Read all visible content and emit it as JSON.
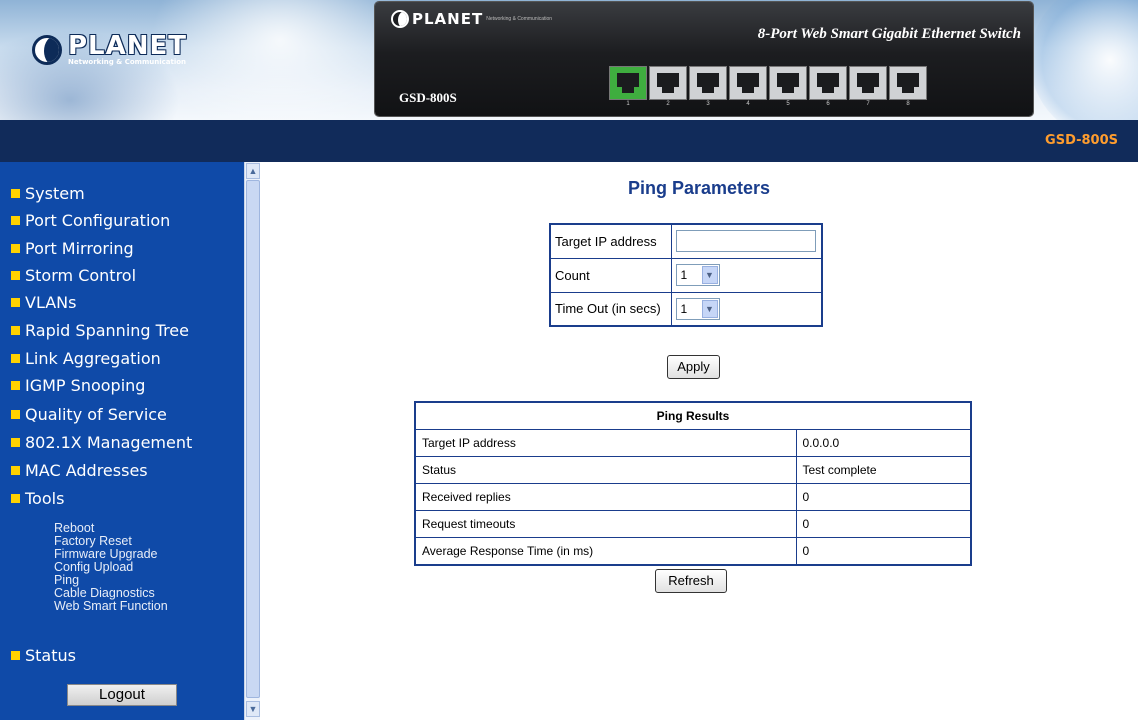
{
  "banner": {
    "brand": "PLANET",
    "brand_tagline": "Networking & Communication",
    "device_title": "8-Port Web Smart Gigabit Ethernet Switch",
    "device_model": "GSD-800S",
    "ports": [
      "1",
      "2",
      "3",
      "4",
      "5",
      "6",
      "7",
      "8"
    ],
    "active_port": "1"
  },
  "topbar": {
    "model": "GSD-800S"
  },
  "sidebar": {
    "items": [
      {
        "label": "System"
      },
      {
        "label": "Port Configuration"
      },
      {
        "label": "Port Mirroring"
      },
      {
        "label": "Storm Control"
      },
      {
        "label": "VLANs"
      },
      {
        "label": "Rapid Spanning Tree"
      },
      {
        "label": "Link Aggregation"
      },
      {
        "label": "IGMP Snooping"
      },
      {
        "label": "Quality of Service"
      },
      {
        "label": "802.1X Management"
      },
      {
        "label": "MAC Addresses"
      },
      {
        "label": "Tools"
      }
    ],
    "tools_subitems": [
      {
        "label": "Reboot"
      },
      {
        "label": "Factory Reset"
      },
      {
        "label": "Firmware Upgrade"
      },
      {
        "label": "Config Upload"
      },
      {
        "label": "Ping"
      },
      {
        "label": "Cable Diagnostics"
      },
      {
        "label": "Web Smart Function"
      }
    ],
    "status_label": "Status",
    "logout_label": "Logout"
  },
  "main": {
    "title": "Ping Parameters",
    "params": {
      "target_ip_label": "Target IP address",
      "target_ip_value": "",
      "count_label": "Count",
      "count_value": "1",
      "timeout_label": "Time Out (in secs)",
      "timeout_value": "1"
    },
    "apply_label": "Apply",
    "results": {
      "header": "Ping Results",
      "rows": [
        {
          "label": "Target IP address",
          "value": "0.0.0.0"
        },
        {
          "label": "Status",
          "value": "Test complete"
        },
        {
          "label": "Received replies",
          "value": "0"
        },
        {
          "label": "Request timeouts",
          "value": "0"
        },
        {
          "label": "Average Response Time (in ms)",
          "value": "0"
        }
      ]
    },
    "refresh_label": "Refresh"
  },
  "colors": {
    "sidebar_bg": "#0f4aa8",
    "topbar_bg": "#112b5a",
    "accent_orange": "#ff9d2e",
    "menu_bullet": "#ffd200",
    "title_blue": "#1a3d8c"
  }
}
